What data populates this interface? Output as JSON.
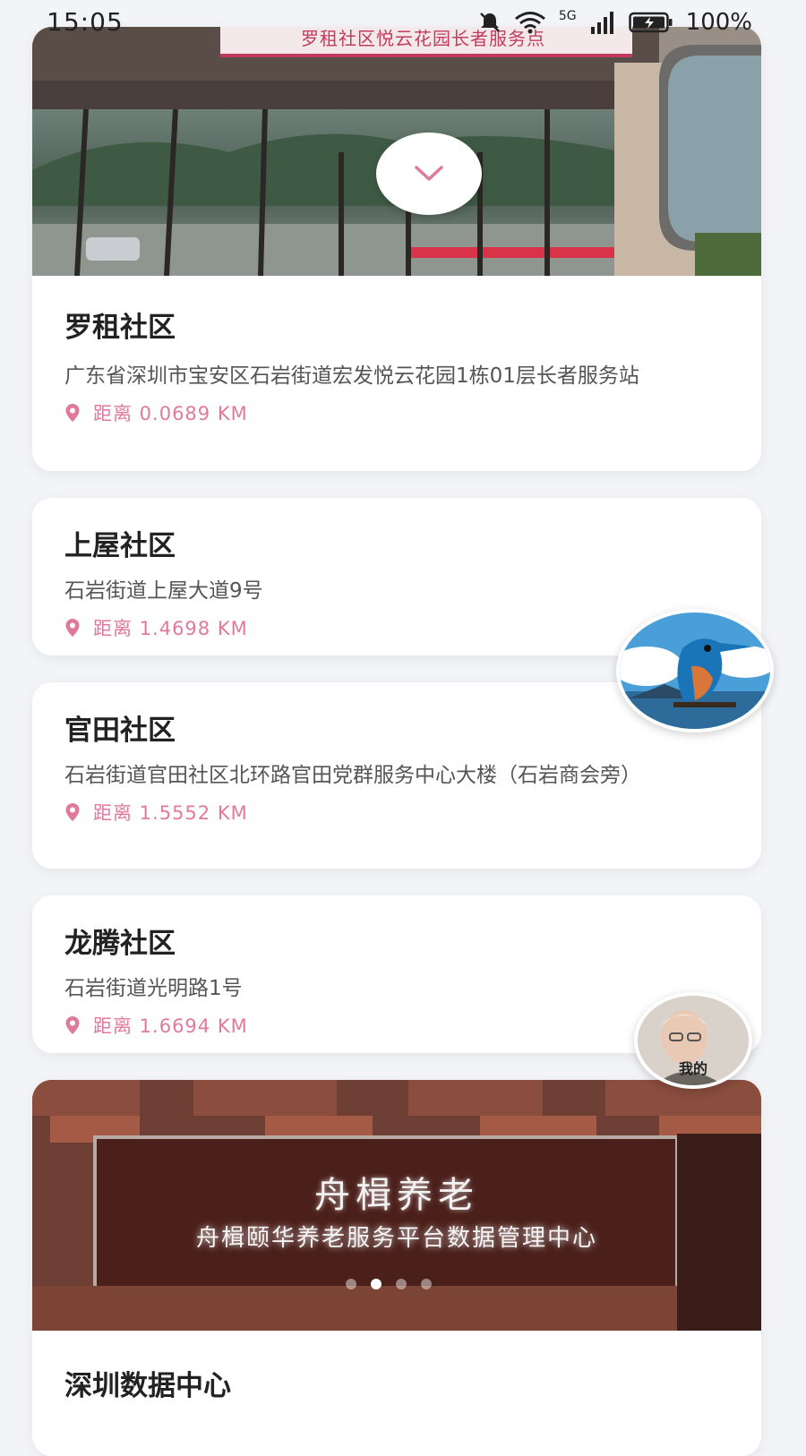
{
  "status_bar": {
    "time": "15:05",
    "battery": "100%",
    "network": "5G"
  },
  "colors": {
    "accent_pink": "#e07a9c",
    "background": "#f3f4f8",
    "card": "#ffffff"
  },
  "cards": [
    {
      "title": "罗租社区",
      "address": "广东省深圳市宝安区石岩街道宏发悦云花园1栋01层长者服务站",
      "distance": "距离 0.0689 KM",
      "photo_sign": "罗租社区悦云花园长者服务点"
    },
    {
      "title": "上屋社区",
      "address": "石岩街道上屋大道9号",
      "distance": "距离 1.4698 KM"
    },
    {
      "title": "官田社区",
      "address": "石岩街道官田社区北环路官田党群服务中心大楼（石岩商会旁）",
      "distance": "距离 1.5552 KM"
    },
    {
      "title": "龙腾社区",
      "address": "石岩街道光明路1号",
      "distance": "距离 1.6694 KM"
    },
    {
      "title": "深圳数据中心",
      "photo_sign_main": "舟楫养老",
      "photo_sign_sub": "舟楫颐华养老服务平台数据管理中心",
      "carousel": {
        "count": 4,
        "active": 1
      }
    }
  ],
  "floating": {
    "mine_label": "我的"
  },
  "icons": {
    "collapse": "chevron-down-icon",
    "location": "location-pin-icon"
  }
}
